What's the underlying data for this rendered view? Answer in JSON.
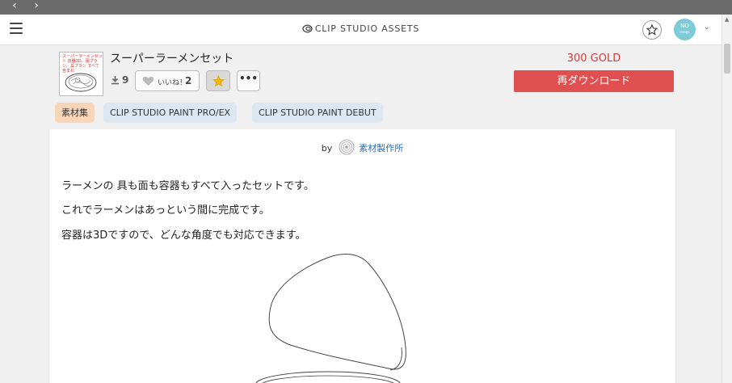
{
  "nav": {
    "back_glyph": "‹",
    "forward_glyph": "›"
  },
  "header": {
    "site_title": "CLIP STUDIO ASSETS",
    "avatar_initials": "NO",
    "avatar_sub": "image",
    "chevron": "⌄"
  },
  "product": {
    "title": "スーパーラーメンセット",
    "thumbnail_text": "スーパーラーメンセット 容器3D、麺プラシ、具プラシ すべて含まれ",
    "download_count": "9",
    "like_label": "いいね！",
    "like_count": "2",
    "more_label": "•••",
    "price": "300 GOLD",
    "redownload_label": "再ダウンロード"
  },
  "tags": {
    "category": "素材集",
    "tag1": "CLIP STUDIO PAINT PRO/EX",
    "tag2": "CLIP STUDIO PAINT DEBUT"
  },
  "content": {
    "by": "by",
    "author": "素材製作所",
    "lines": [
      "ラーメンの 具も面も容器もすべて入ったセットです。",
      "これでラーメンはあっという間に完成です。",
      "容器は3Dですので、どんな角度でも対応できます。"
    ]
  },
  "colors": {
    "accent_red": "#e05050",
    "price_red": "#d23b3b",
    "link_blue": "#2b6db8",
    "tag_category": "#f7d5b8",
    "tag_app": "#dde7f2",
    "favorite_star": "#f2b705"
  },
  "icons": [
    "chevron-left-icon",
    "chevron-right-icon",
    "hamburger-icon",
    "logo-icon",
    "star-icon",
    "download-icon",
    "heart-icon",
    "ellipsis-icon"
  ]
}
